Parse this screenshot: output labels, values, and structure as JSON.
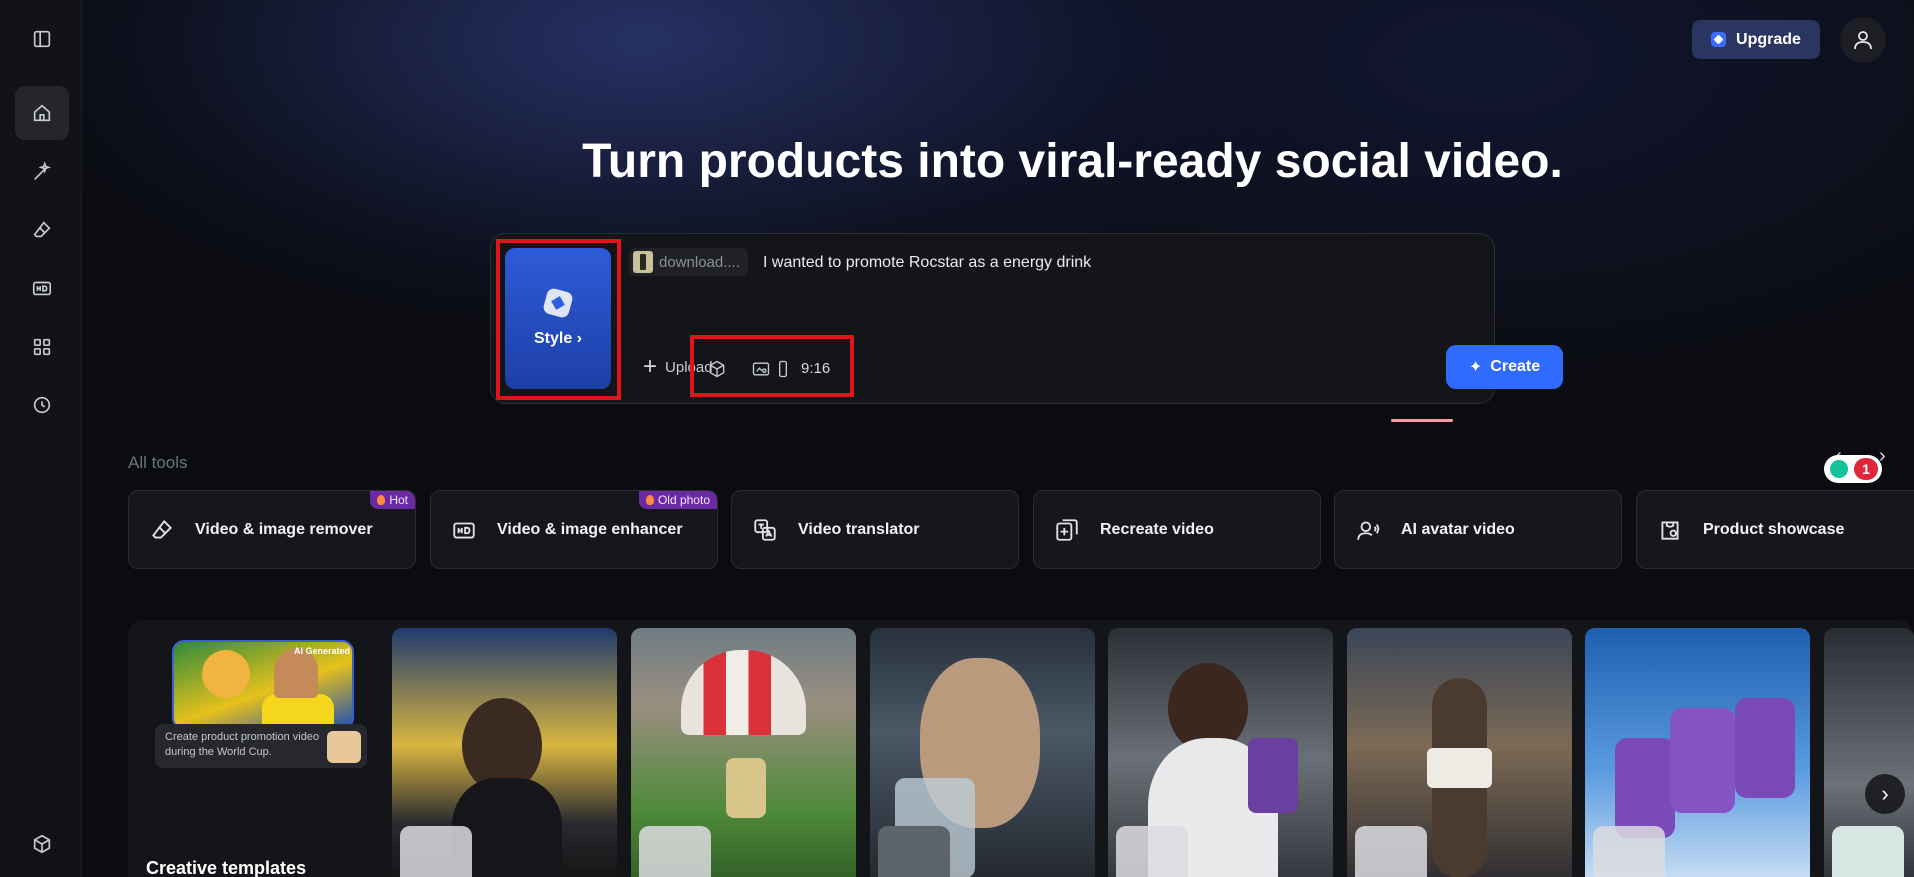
{
  "header": {
    "upgrade_label": "Upgrade"
  },
  "hero": {
    "headline": "Turn products into viral-ready social video."
  },
  "prompt": {
    "style_label": "Style",
    "file_name": "download....",
    "text": "I wanted to promote Rocstar as a energy drink",
    "upload_label": "Upload",
    "aspect_ratio": "9:16",
    "create_label": "Create"
  },
  "tools": {
    "section_label": "All tools",
    "items": [
      {
        "label": "Video & image remover",
        "badge": "Hot",
        "icon": "eraser-icon"
      },
      {
        "label": "Video & image enhancer",
        "badge": "Old photo",
        "icon": "hd-icon"
      },
      {
        "label": "Video translator",
        "badge": "",
        "icon": "translate-icon"
      },
      {
        "label": "Recreate video",
        "badge": "",
        "icon": "recreate-icon"
      },
      {
        "label": "AI avatar video",
        "badge": "",
        "icon": "avatar-voice-icon"
      },
      {
        "label": "Product showcase",
        "badge": "",
        "icon": "product-icon"
      }
    ]
  },
  "templates": {
    "ai_tag": "AI Generated",
    "caption": "Create product promotion video during the World Cup.",
    "title": "Creative templates"
  },
  "grammarly": {
    "count": "1"
  },
  "colors": {
    "accent": "#2f6bff",
    "highlight_box": "#e1141d",
    "badge": "#6b2aa3",
    "background": "#0b0c10"
  }
}
